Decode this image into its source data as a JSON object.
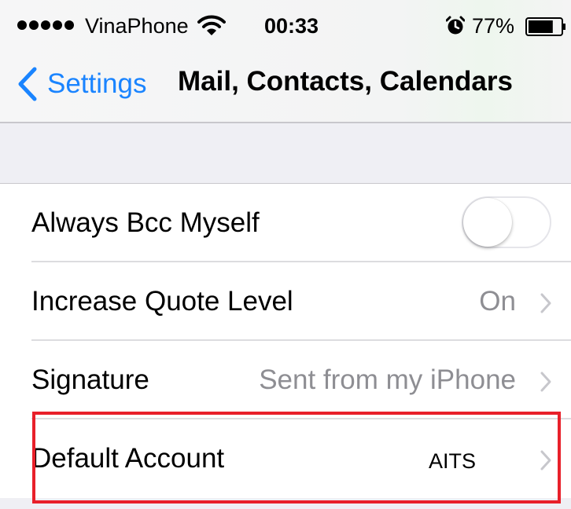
{
  "status_bar": {
    "signal_icon": "signal-dots-icon",
    "carrier": "VinaPhone",
    "wifi_icon": "wifi-icon",
    "time": "00:33",
    "alarm_icon": "alarm-clock-icon",
    "battery_percent": "77%",
    "battery_level": 0.77,
    "battery_icon": "battery-icon"
  },
  "nav": {
    "back_label": "Settings",
    "back_icon": "chevron-left-icon",
    "title": "Mail, Contacts, Calendars"
  },
  "rows": [
    {
      "label": "Always Bcc Myself",
      "control": "toggle",
      "toggle_on": false
    },
    {
      "label": "Increase Quote Level",
      "value": "On",
      "icon": "chevron-right-icon"
    },
    {
      "label": "Signature",
      "value": "Sent from my iPhone",
      "icon": "chevron-right-icon"
    },
    {
      "label": "Default Account",
      "value": "AITS",
      "icon": "chevron-right-icon",
      "highlighted": true
    }
  ],
  "colors": {
    "accent": "#1a84ff",
    "secondary_text": "#8e8e93",
    "grouped_background": "#efeff4",
    "highlight": "#e8202a"
  }
}
